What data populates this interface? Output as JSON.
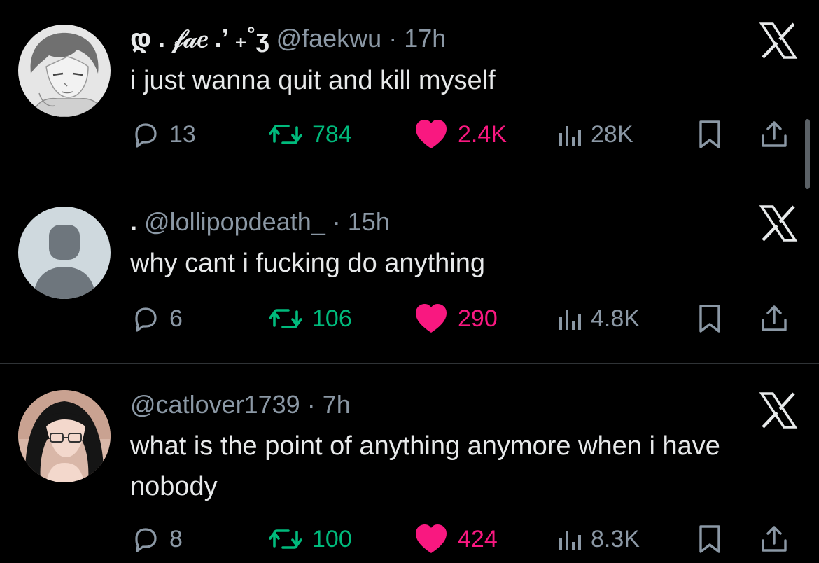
{
  "posts": [
    {
      "display_name": "დ . 𝒻𝒶𝑒 .’ ₊˚ʒ",
      "handle": "@faekwu",
      "separator": "·",
      "time": "17h",
      "text": "i just wanna quit and kill myself",
      "replies": "13",
      "reposts": "784",
      "likes": "2.4K",
      "views": "28K",
      "avatar": "anime-sketch-boy"
    },
    {
      "display_name": ".",
      "handle": "@lollipopdeath_",
      "separator": "·",
      "time": "15h",
      "text": "why cant i fucking do anything",
      "replies": "6",
      "reposts": "106",
      "likes": "290",
      "views": "4.8K",
      "avatar": "default-profile"
    },
    {
      "display_name": "",
      "handle": "@catlover1739",
      "separator": "·",
      "time": "7h",
      "text": "what is the point of anything anymore when i have nobody",
      "replies": "8",
      "reposts": "100",
      "likes": "424",
      "views": "8.3K",
      "avatar": "anime-girl-glasses"
    }
  ],
  "icons": {
    "reply": "reply-icon",
    "repost": "repost-icon",
    "like": "heart-icon",
    "views": "views-icon",
    "bookmark": "bookmark-icon",
    "share": "share-icon",
    "close": "x-logo-icon"
  },
  "colors": {
    "background": "#000000",
    "text": "#e7e9ea",
    "muted": "#8b98a5",
    "repost_green": "#00ba7c",
    "like_pink": "#f91880",
    "divider": "#2f3336"
  }
}
